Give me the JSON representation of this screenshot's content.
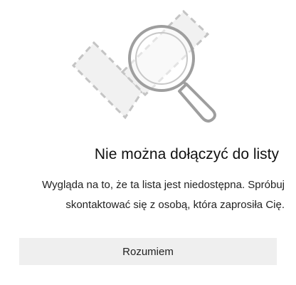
{
  "dialog": {
    "illustration_icon": "search-magnifier-icon",
    "title": "Nie można dołączyć do listy",
    "message_line_1": "Wygląda na to, że ta lista jest niedostępna. Spróbuj",
    "message_line_2": "skontaktować się z osobą, która zaprosiła Cię.",
    "ok_label": "Rozumiem"
  },
  "colors": {
    "illustration_stroke": "#bdbdbd",
    "illustration_fill": "#f0f0f0",
    "button_bg": "#efefef"
  }
}
